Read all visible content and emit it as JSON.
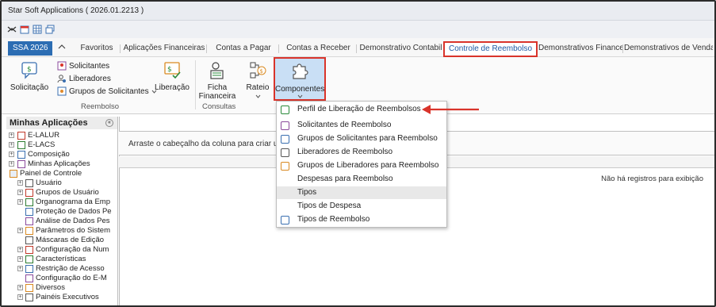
{
  "window": {
    "title": "Star Soft Applications ( 2026.01.2213 )"
  },
  "quick_access": [
    "app-icon",
    "calendar-icon",
    "grid-icon",
    "window-icon"
  ],
  "app_tab": "SSA 2026",
  "ribbon_tabs": [
    "Favoritos",
    "Aplicações Financeiras",
    "Contas a Pagar",
    "Contas a Receber",
    "Demonstrativo Contabil",
    "Controle de Reembolso",
    "Demonstrativos Financei",
    "Demonstrativos de Venda"
  ],
  "ribbon": {
    "solicitacao": "Solicitação",
    "solicitantes": "Solicitantes",
    "liberadores": "Liberadores",
    "grupos_solicitantes": "Grupos de Solicitantes",
    "liberacao": "Liberação",
    "ficha_line1": "Ficha",
    "ficha_line2": "Financeira",
    "rateio": "Rateio",
    "componentes": "Componentes",
    "group_reembolso": "Reembolso",
    "group_consultas": "Consultas"
  },
  "sidebar": {
    "title": "Minhas Aplicações",
    "items": [
      {
        "label": "E-LALUR",
        "level": "top"
      },
      {
        "label": "E-LACS",
        "level": "top"
      },
      {
        "label": "Composição",
        "level": "top"
      },
      {
        "label": "Minhas Aplicações",
        "level": "top"
      },
      {
        "label": "Painel de Controle",
        "level": "root"
      },
      {
        "label": "Usuário",
        "level": "child"
      },
      {
        "label": "Grupos de Usuário",
        "level": "child"
      },
      {
        "label": "Organograma da Emp",
        "level": "child"
      },
      {
        "label": "Proteção de Dados Pe",
        "level": "leaf"
      },
      {
        "label": "Análise de Dados Pes",
        "level": "leaf"
      },
      {
        "label": "Parâmetros do Sistem",
        "level": "child"
      },
      {
        "label": "Máscaras de Edição",
        "level": "leaf"
      },
      {
        "label": "Configuração da Num",
        "level": "child"
      },
      {
        "label": "Características",
        "level": "child"
      },
      {
        "label": "Restrição de Acesso",
        "level": "child"
      },
      {
        "label": "Configuração do E-M",
        "level": "leaf"
      },
      {
        "label": "Diversos",
        "level": "child"
      },
      {
        "label": "Painéis Executivos",
        "level": "child"
      }
    ]
  },
  "main": {
    "group_hint": "Arraste o cabeçalho da coluna para criar um a",
    "no_records": "Não há registros para exibição"
  },
  "dropdown": [
    "Perfil de Liberação de Reembolsos",
    "Solicitantes de Reembolso",
    "Grupos de Solicitantes para Reembolso",
    "Liberadores de Reembolso",
    "Grupos de Liberadores para Reembolso",
    "Despesas para Reembolso",
    "Tipos",
    "Tipos de Despesa",
    "Tipos de Reembolso"
  ],
  "colors": {
    "accent": "#2c6db3",
    "highlight_border": "#d9342b",
    "selected_button": "#c9dff5"
  }
}
